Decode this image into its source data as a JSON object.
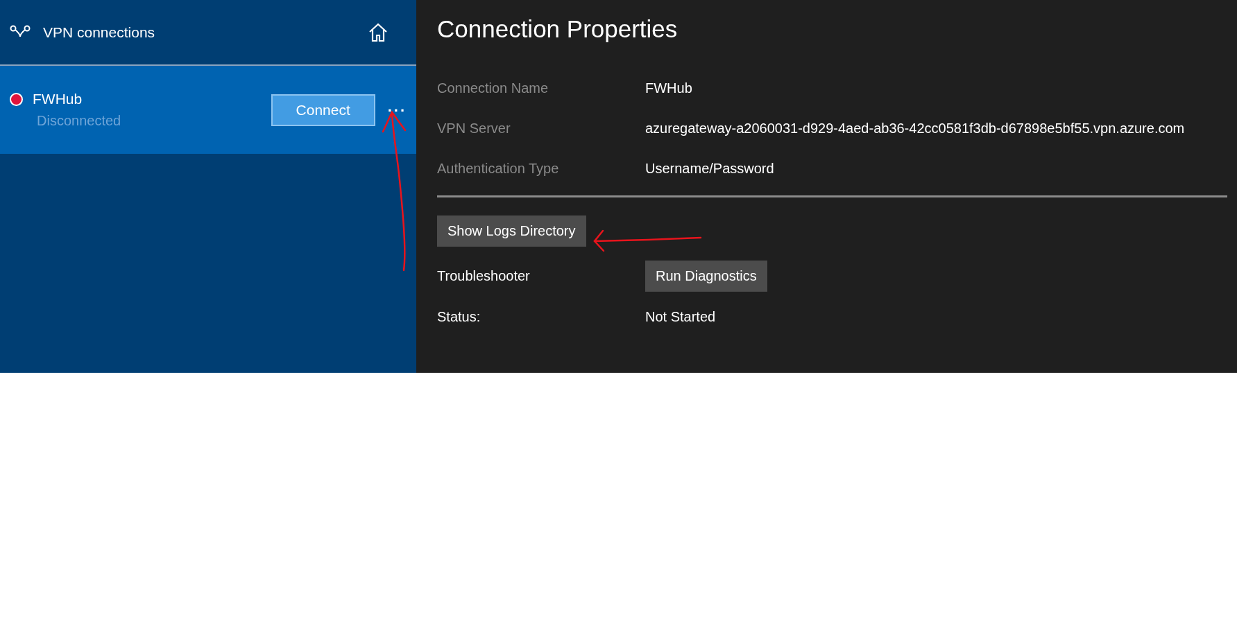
{
  "sidebar": {
    "title": "VPN connections",
    "connections": [
      {
        "name": "FWHub",
        "status": "Disconnected",
        "color": "#e0143c",
        "selected": true,
        "button": "Connect",
        "more": "..."
      }
    ]
  },
  "properties": {
    "title": "Connection Properties",
    "fields": [
      {
        "label": "Connection Name",
        "value": "FWHub"
      },
      {
        "label": "VPN Server",
        "value": "azuregateway-a2060031-d929-4aed-ab36-42cc0581f3db-d67898e5bf55.vpn.azure.com"
      },
      {
        "label": "Authentication Type",
        "value": "Username/Password"
      }
    ],
    "logs_button": "Show Logs Directory",
    "troubleshooter": {
      "label": "Troubleshooter",
      "button": "Run Diagnostics"
    },
    "status": {
      "label": "Status:",
      "value": "Not Started"
    }
  }
}
